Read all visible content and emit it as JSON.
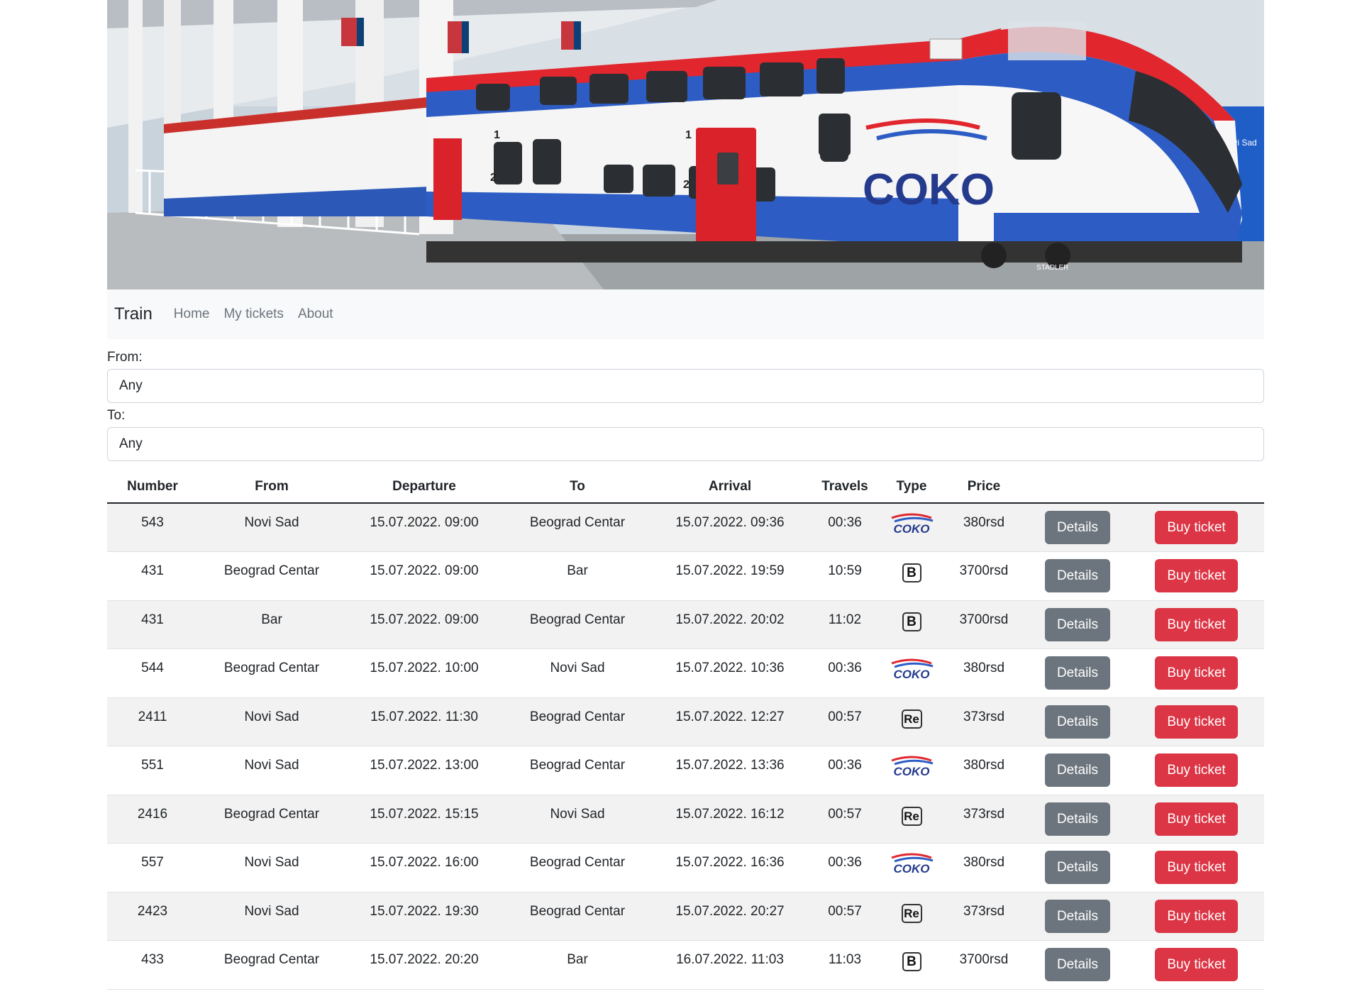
{
  "hero": {
    "train_logo_text": "COKO",
    "sign_text": "Novi Sad",
    "maker_text": "STADLER",
    "door_numbers": [
      "1",
      "2",
      "1",
      "2"
    ]
  },
  "navbar": {
    "brand": "Train",
    "links": [
      "Home",
      "My tickets",
      "About"
    ]
  },
  "filters": {
    "from_label": "From:",
    "from_value": "Any",
    "to_label": "To:",
    "to_value": "Any"
  },
  "table": {
    "headers": [
      "Number",
      "From",
      "Departure",
      "To",
      "Arrival",
      "Travels",
      "Type",
      "Price"
    ],
    "details_label": "Details",
    "buy_label": "Buy ticket",
    "coko_text": "COKO",
    "rows": [
      {
        "number": "543",
        "from": "Novi Sad",
        "departure": "15.07.2022. 09:00",
        "to": "Beograd Centar",
        "arrival": "15.07.2022. 09:36",
        "travels": "00:36",
        "type": "coko",
        "type_label": "",
        "price": "380rsd"
      },
      {
        "number": "431",
        "from": "Beograd Centar",
        "departure": "15.07.2022. 09:00",
        "to": "Bar",
        "arrival": "15.07.2022. 19:59",
        "travels": "10:59",
        "type": "b",
        "type_label": "B",
        "price": "3700rsd"
      },
      {
        "number": "431",
        "from": "Bar",
        "departure": "15.07.2022. 09:00",
        "to": "Beograd Centar",
        "arrival": "15.07.2022. 20:02",
        "travels": "11:02",
        "type": "b",
        "type_label": "B",
        "price": "3700rsd"
      },
      {
        "number": "544",
        "from": "Beograd Centar",
        "departure": "15.07.2022. 10:00",
        "to": "Novi Sad",
        "arrival": "15.07.2022. 10:36",
        "travels": "00:36",
        "type": "coko",
        "type_label": "",
        "price": "380rsd"
      },
      {
        "number": "2411",
        "from": "Novi Sad",
        "departure": "15.07.2022. 11:30",
        "to": "Beograd Centar",
        "arrival": "15.07.2022. 12:27",
        "travels": "00:57",
        "type": "re",
        "type_label": "Re",
        "price": "373rsd"
      },
      {
        "number": "551",
        "from": "Novi Sad",
        "departure": "15.07.2022. 13:00",
        "to": "Beograd Centar",
        "arrival": "15.07.2022. 13:36",
        "travels": "00:36",
        "type": "coko",
        "type_label": "",
        "price": "380rsd"
      },
      {
        "number": "2416",
        "from": "Beograd Centar",
        "departure": "15.07.2022. 15:15",
        "to": "Novi Sad",
        "arrival": "15.07.2022. 16:12",
        "travels": "00:57",
        "type": "re",
        "type_label": "Re",
        "price": "373rsd"
      },
      {
        "number": "557",
        "from": "Novi Sad",
        "departure": "15.07.2022. 16:00",
        "to": "Beograd Centar",
        "arrival": "15.07.2022. 16:36",
        "travels": "00:36",
        "type": "coko",
        "type_label": "",
        "price": "380rsd"
      },
      {
        "number": "2423",
        "from": "Novi Sad",
        "departure": "15.07.2022. 19:30",
        "to": "Beograd Centar",
        "arrival": "15.07.2022. 20:27",
        "travels": "00:57",
        "type": "re",
        "type_label": "Re",
        "price": "373rsd"
      },
      {
        "number": "433",
        "from": "Beograd Centar",
        "departure": "15.07.2022. 20:20",
        "to": "Bar",
        "arrival": "16.07.2022. 11:03",
        "travels": "11:03",
        "type": "b",
        "type_label": "B",
        "price": "3700rsd"
      }
    ]
  }
}
